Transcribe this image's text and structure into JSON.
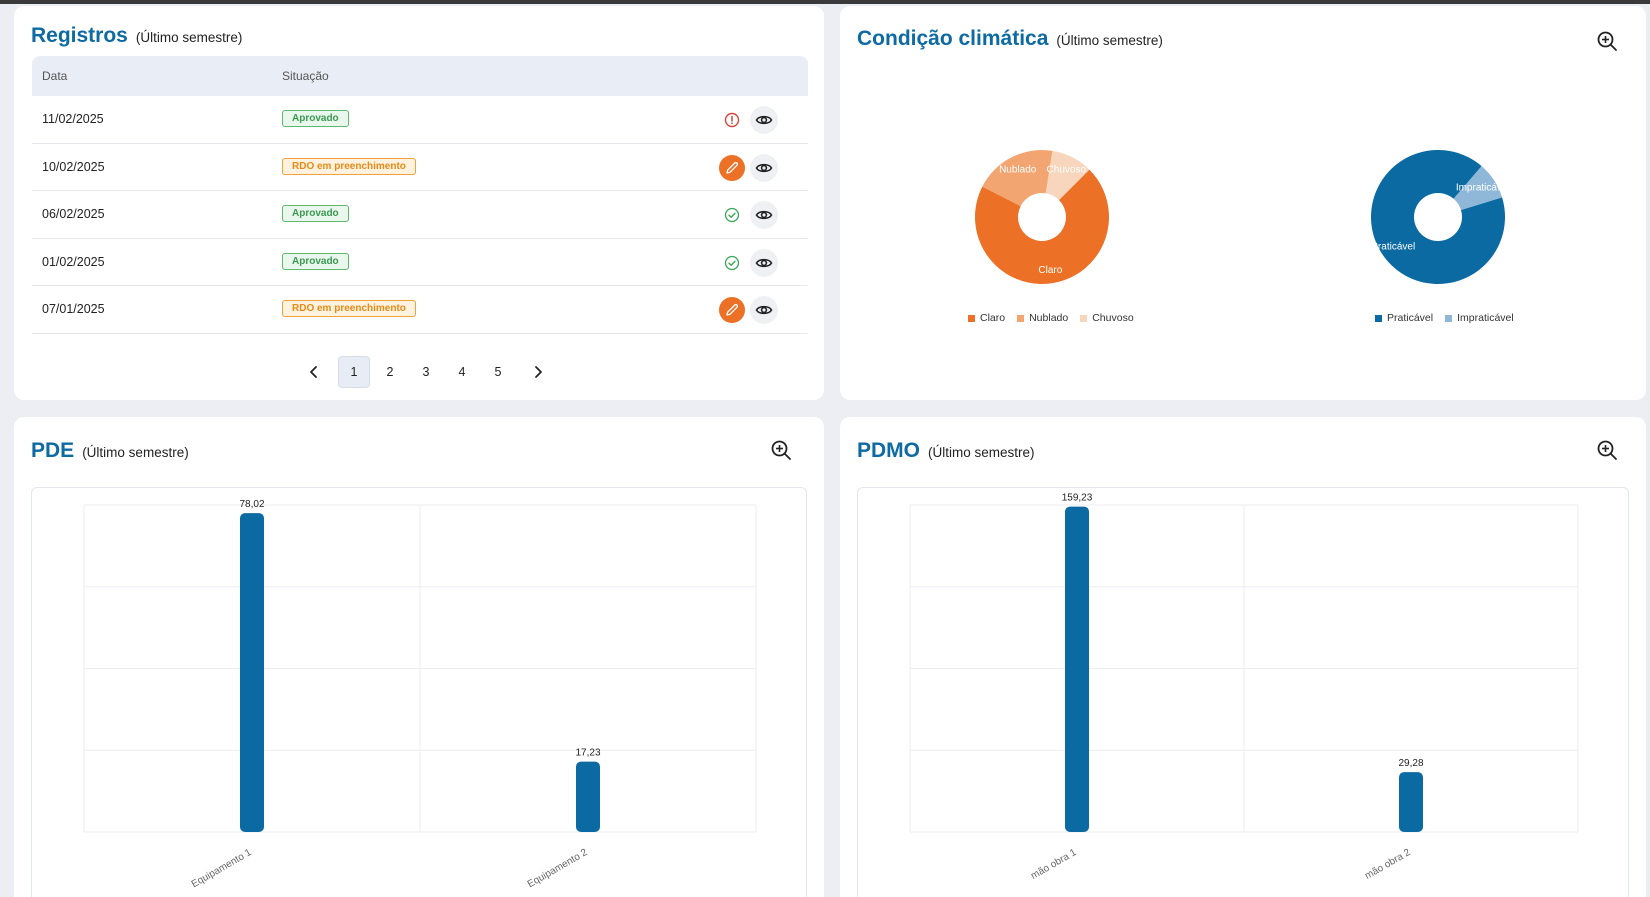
{
  "registros": {
    "title": "Registros",
    "subtitle": "(Último semestre)",
    "columns": {
      "date": "Data",
      "status": "Situação"
    },
    "rows": [
      {
        "date": "11/02/2025",
        "status": "Aprovado",
        "status_type": "ok",
        "action": "alert-icon"
      },
      {
        "date": "10/02/2025",
        "status": "RDO em preenchimento",
        "status_type": "fill",
        "action": "edit-icon"
      },
      {
        "date": "06/02/2025",
        "status": "Aprovado",
        "status_type": "ok",
        "action": "check-icon"
      },
      {
        "date": "01/02/2025",
        "status": "Aprovado",
        "status_type": "ok",
        "action": "check-icon"
      },
      {
        "date": "07/01/2025",
        "status": "RDO em preenchimento",
        "status_type": "fill",
        "action": "edit-icon"
      }
    ],
    "pagination": {
      "pages": [
        "1",
        "2",
        "3",
        "4",
        "5"
      ],
      "current": "1"
    }
  },
  "clima": {
    "title": "Condição climática",
    "subtitle": "(Último semestre)"
  },
  "pde": {
    "title": "PDE",
    "subtitle": "(Último semestre)"
  },
  "pdmo": {
    "title": "PDMO",
    "subtitle": "(Último semestre)"
  },
  "colors": {
    "primary": "#0d6aa2",
    "bar": "#0b6aa2",
    "claro": "#ec7126",
    "nublado": "#f2a570",
    "chuvoso": "#f8d6bd",
    "praticavel": "#0b6aa2",
    "impraticavel": "#8fb8d8"
  },
  "chart_data": [
    {
      "type": "pie",
      "labels": [
        "Claro",
        "Nublado",
        "Chuvoso"
      ],
      "values": [
        70,
        20,
        10
      ],
      "colors": [
        "#ec7126",
        "#f2a570",
        "#f8d6bd"
      ],
      "legend": "bottom"
    },
    {
      "type": "pie",
      "labels": [
        "Praticável",
        "Impraticável"
      ],
      "values": [
        91,
        9
      ],
      "colors": [
        "#0b6aa2",
        "#8fb8d8"
      ],
      "legend": "bottom"
    },
    {
      "type": "bar",
      "categories": [
        "Equipamento 1",
        "Equipamento 2"
      ],
      "values": [
        78.02,
        17.23
      ],
      "value_labels": [
        "78,02",
        "17,23"
      ],
      "ylim": [
        0,
        80
      ],
      "grid": true
    },
    {
      "type": "bar",
      "categories": [
        "mão obra 1",
        "mão obra 2"
      ],
      "values": [
        159.23,
        29.28
      ],
      "value_labels": [
        "159,23",
        "29,28"
      ],
      "ylim": [
        0,
        160
      ],
      "grid": true
    }
  ]
}
